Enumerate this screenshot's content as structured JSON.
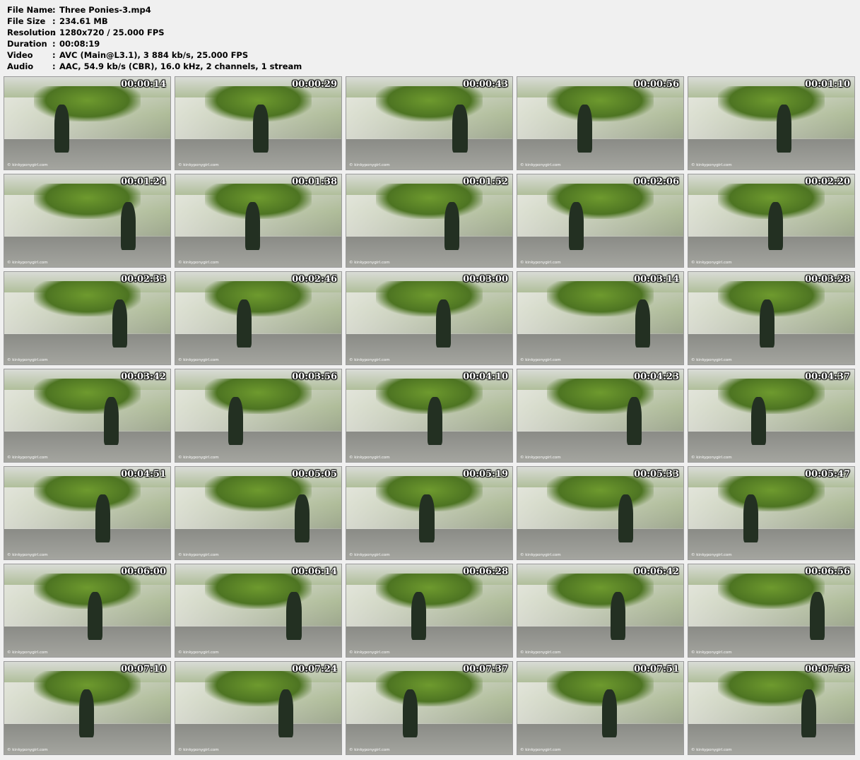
{
  "info": [
    {
      "key": "File Name",
      "value": "Three Ponies-3.mp4"
    },
    {
      "key": "File Size",
      "value": "234.61 MB"
    },
    {
      "key": "Resolution",
      "value": "1280x720 / 25.000 FPS"
    },
    {
      "key": "Duration",
      "value": "00:08:19"
    },
    {
      "key": "Video",
      "value": "AVC (Main@L3.1), 3 884 kb/s, 25.000 FPS"
    },
    {
      "key": "Audio",
      "value": "AAC, 54.9 kb/s (CBR), 16.0 kHz, 2 channels, 1 stream"
    }
  ],
  "separator": ":",
  "watermark": "© kinkyponygirl.com",
  "thumbnails": [
    "00:00:14",
    "00:00:29",
    "00:00:43",
    "00:00:56",
    "00:01:10",
    "00:01:24",
    "00:01:38",
    "00:01:52",
    "00:02:06",
    "00:02:20",
    "00:02:33",
    "00:02:46",
    "00:03:00",
    "00:03:14",
    "00:03:28",
    "00:03:42",
    "00:03:56",
    "00:04:10",
    "00:04:23",
    "00:04:37",
    "00:04:51",
    "00:05:05",
    "00:05:19",
    "00:05:33",
    "00:05:47",
    "00:06:00",
    "00:06:14",
    "00:06:28",
    "00:06:42",
    "00:06:56",
    "00:07:10",
    "00:07:24",
    "00:07:37",
    "00:07:51",
    "00:07:58"
  ]
}
